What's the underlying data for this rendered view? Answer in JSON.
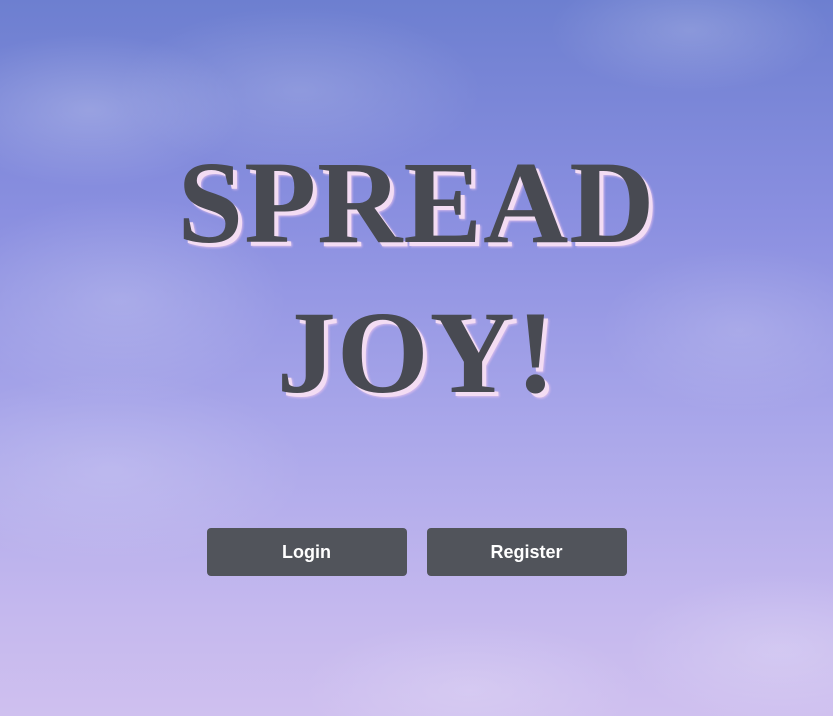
{
  "hero": {
    "line1": "SPREAD",
    "line2": "JOY!"
  },
  "actions": {
    "login_label": "Login",
    "register_label": "Register"
  },
  "colors": {
    "headline_text": "#484a52",
    "headline_shadow": "#f3dcf3",
    "button_bg": "#51545b",
    "button_text": "#ffffff",
    "sky_top": "#6d7fd0",
    "sky_bottom": "#cfc0ef"
  }
}
